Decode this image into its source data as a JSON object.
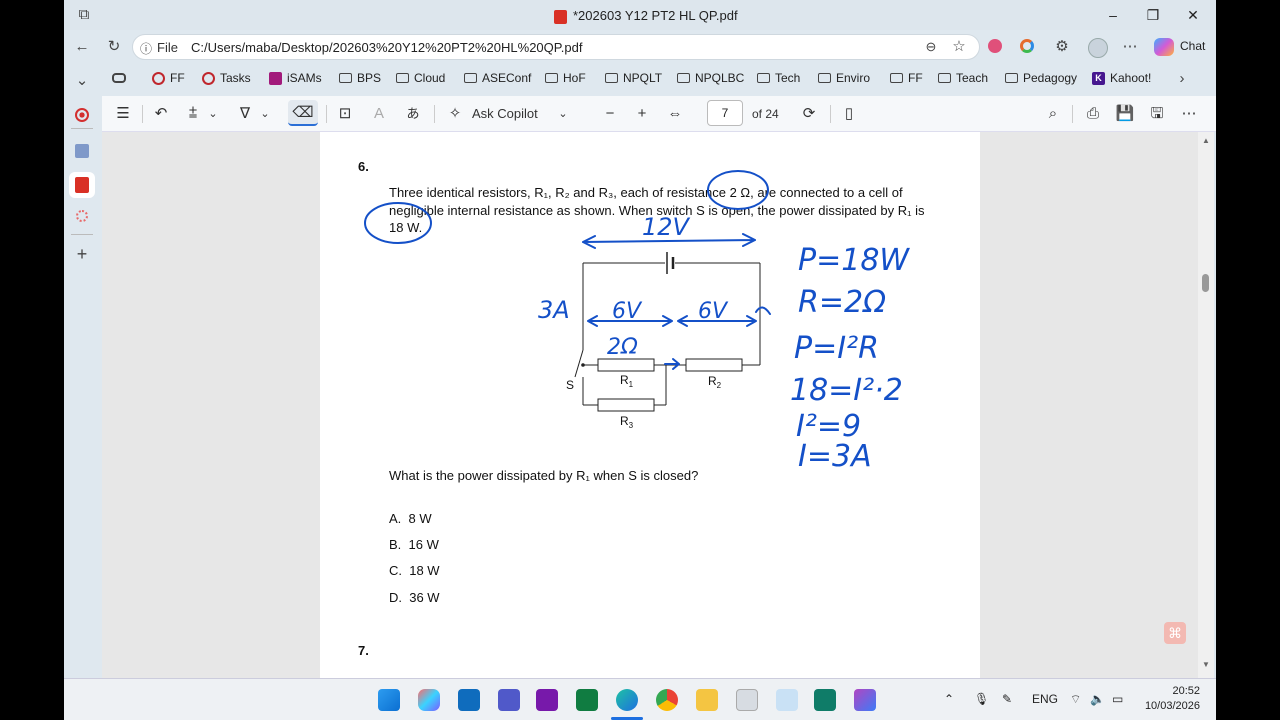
{
  "window": {
    "title": "*202603 Y12 PT2 HL QP.pdf",
    "minimize": "–",
    "maximize": "❐",
    "close": "✕"
  },
  "address": {
    "file_label": "File",
    "url": "C:/Users/maba/Desktop/202603%20Y12%20PT2%20HL%20QP.pdf",
    "chat_label": "Chat"
  },
  "bookmarks": [
    {
      "label": "FF",
      "icon": "red-circle-icon"
    },
    {
      "label": "Tasks",
      "icon": "red-circle-icon"
    },
    {
      "label": "iSAMs",
      "icon": "isams-icon"
    },
    {
      "label": "BPS",
      "icon": "folder-icon"
    },
    {
      "label": "Cloud",
      "icon": "folder-icon"
    },
    {
      "label": "ASEConf",
      "icon": "folder-icon"
    },
    {
      "label": "HoF",
      "icon": "folder-icon"
    },
    {
      "label": "NPQLT",
      "icon": "folder-icon"
    },
    {
      "label": "NPQLBC",
      "icon": "folder-icon"
    },
    {
      "label": "Tech",
      "icon": "folder-icon"
    },
    {
      "label": "Enviro",
      "icon": "folder-icon"
    },
    {
      "label": "FF",
      "icon": "folder-icon"
    },
    {
      "label": "Teach",
      "icon": "folder-icon"
    },
    {
      "label": "Pedagogy",
      "icon": "folder-icon"
    },
    {
      "label": "Kahoot!",
      "icon": "kahoot-icon"
    }
  ],
  "toolbar": {
    "copilot_label": "Ask Copilot",
    "page_current": "7",
    "page_total": "of 24",
    "minus": "−",
    "plus": "+"
  },
  "question6": {
    "number": "6.",
    "text_line1": "Three identical resistors, R₁, R₂ and R₃, each of resistance 2 Ω, are connected to a cell of",
    "text_line2": "negligible internal resistance as shown. When switch S is open, the power dissipated by R₁ is",
    "text_line3": "18 W.",
    "prompt": "What is the power dissipated by R₁ when S is closed?",
    "options": [
      {
        "letter": "A.",
        "value": "8 W"
      },
      {
        "letter": "B.",
        "value": "16 W"
      },
      {
        "letter": "C.",
        "value": "18 W"
      },
      {
        "letter": "D.",
        "value": "36 W"
      }
    ]
  },
  "circuit": {
    "r1": "R",
    "r1_sub": "1",
    "r2": "R",
    "r2_sub": "2",
    "r3": "R",
    "r3_sub": "3",
    "switch": "S"
  },
  "annotations": {
    "top_voltage": "12V",
    "left_current": "3A",
    "v1": "6V",
    "v2": "6V",
    "res": "2Ω",
    "workings": [
      "P=18W",
      "R=2Ω",
      "P=I²R",
      "18=I²·2",
      "I²=9",
      "I=3A"
    ]
  },
  "question7": {
    "number": "7."
  },
  "system": {
    "language": "ENG",
    "time": "20:52",
    "date": "10/03/2026"
  }
}
